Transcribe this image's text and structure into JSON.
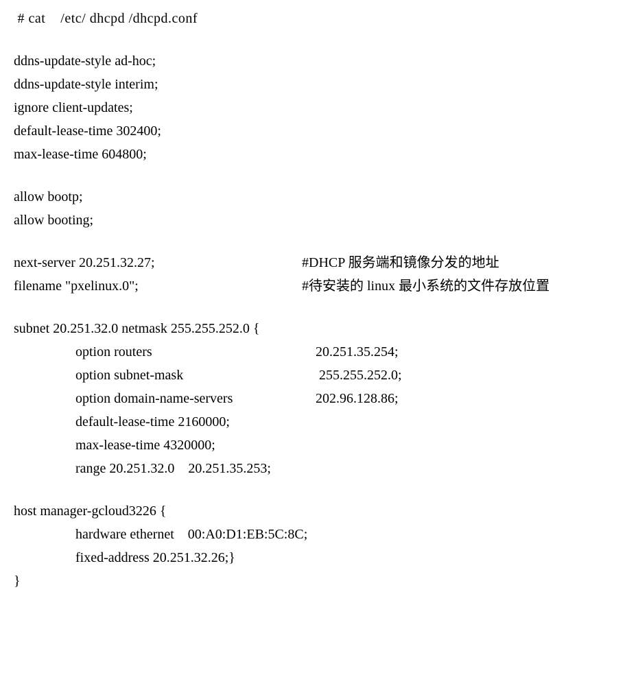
{
  "header": " # cat    /etc/ dhcpd /dhcpd.conf",
  "l1": "ddns-update-style ad-hoc;",
  "l2": "ddns-update-style interim;",
  "l3": "ignore client-updates;",
  "l4": "default-lease-time 302400;",
  "l5": "max-lease-time 604800;",
  "l6": "allow bootp;",
  "l7": "allow booting;",
  "ns_left": "next-server 20.251.32.27;",
  "ns_right": "#DHCP 服务端和镜像分发的地址",
  "fn_left": "filename \"pxelinux.0\";",
  "fn_right": "#待安装的 linux 最小系统的文件存放位置",
  "subnet": "subnet 20.251.32.0 netmask 255.255.252.0 {",
  "opt_routers_l": "option routers",
  "opt_routers_r": "20.251.35.254;",
  "opt_mask_l": "option subnet-mask",
  "opt_mask_r": " 255.255.252.0;",
  "opt_dns_l": "option domain-name-servers",
  "opt_dns_r": "202.96.128.86;",
  "dlt": "default-lease-time 2160000;",
  "mlt": "max-lease-time 4320000;",
  "range": "range 20.251.32.0    20.251.35.253;",
  "host": "host manager-gcloud3226 {",
  "hw": "hardware ethernet    00:A0:D1:EB:5C:8C;",
  "fixed": "fixed-address 20.251.32.26;}",
  "close": "}"
}
